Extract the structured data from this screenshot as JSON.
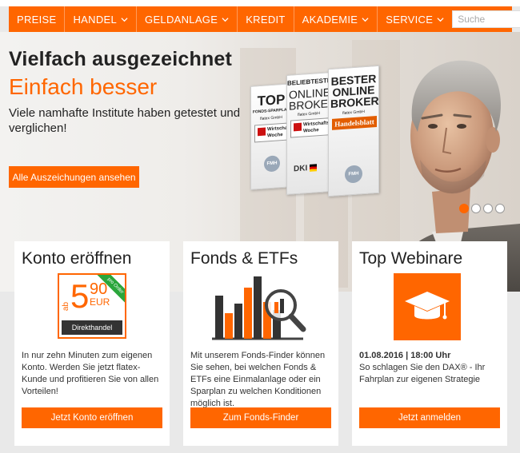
{
  "nav": {
    "items": [
      {
        "label": "PREISE",
        "dropdown": false
      },
      {
        "label": "HANDEL",
        "dropdown": true
      },
      {
        "label": "GELDANLAGE",
        "dropdown": true
      },
      {
        "label": "KREDIT",
        "dropdown": false
      },
      {
        "label": "AKADEMIE",
        "dropdown": true
      },
      {
        "label": "SERVICE",
        "dropdown": true
      }
    ],
    "search_placeholder": "Suche",
    "search_icon": "magnifier-icon"
  },
  "hero": {
    "title": "Vielfach ausgezeichnet",
    "subtitle": "Einfach besser",
    "text": "Viele namhafte Institute haben getestet und verglichen!",
    "button": "Alle Auszeichungen ansehen",
    "awards": {
      "a1_title": "TOP",
      "a1_sub": "FONDS-SPARPLAN",
      "a1_brand": "flatex GmbH",
      "a1_mag": "Wirtschafts Woche",
      "a2_top": "BELIEBTESTER",
      "a2_title": "ONLINE BROKER",
      "a2_brand": "flatex GmbH",
      "a2_mag": "Wirtschafts Woche",
      "a3_title": "BESTER ONLINE BROKER",
      "a3_brand": "flatex GmbH",
      "a3_mag": "Handelsblatt",
      "fmh": "FMH",
      "dki": "DKI"
    },
    "slides": 4,
    "active_slide": 1
  },
  "cards": [
    {
      "title": "Konto eröffnen",
      "price_prefix": "ab",
      "price_int": "5",
      "price_dec": "90",
      "price_cur": "EUR",
      "badge": "pro Order",
      "price_label": "Direkthandel",
      "text": "In nur zehn Minuten zum eigenen Konto. Werden Sie jetzt flatex-Kunde und profitieren Sie von allen Vorteilen!",
      "button": "Jetzt Konto eröffnen"
    },
    {
      "title": "Fonds & ETFs",
      "text": "Mit unserem Fonds-Finder können Sie sehen, bei welchen Fonds & ETFs eine Einmalanlage oder ein Sparplan zu welchen Konditionen möglich ist.",
      "button": "Zum Fonds-Finder"
    },
    {
      "title": "Top Webinare",
      "date": "01.08.2016 | 18:00 Uhr",
      "text": "So schlagen Sie den DAX® - Ihr Fahrplan zur eigenen Strategie",
      "button": "Jetzt anmelden"
    }
  ],
  "colors": {
    "brand": "#ff6600",
    "text": "#222222",
    "dark_box": "#333333"
  }
}
